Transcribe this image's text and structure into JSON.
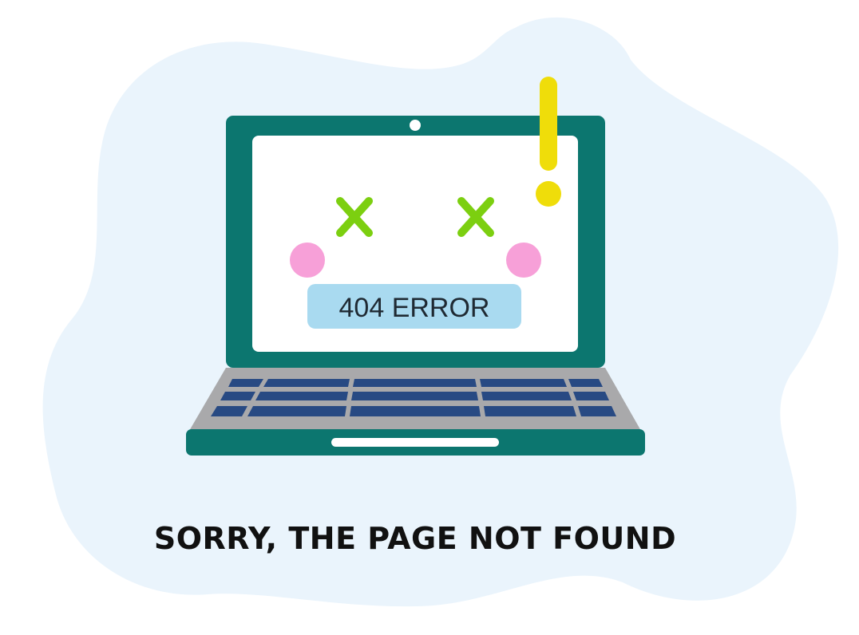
{
  "screen": {
    "error_label": "404 ERROR"
  },
  "message": {
    "headline": "SORRY, THE PAGE NOT FOUND"
  },
  "icons": {
    "background": "blob-shape",
    "device": "laptop-icon",
    "eyes": "x-mark-icon",
    "cheeks": "blush-circle",
    "alert": "exclamation-icon"
  },
  "colors": {
    "blob": "#eaf4fc",
    "laptop_body": "#0c766f",
    "screen": "#ffffff",
    "keyboard_deck": "#a9a9ab",
    "keys": "#284a83",
    "eyes": "#7ccf10",
    "cheeks": "#f7a0d8",
    "error_badge": "#a9daf0",
    "exclamation": "#efdd0a",
    "text": "#111111"
  }
}
